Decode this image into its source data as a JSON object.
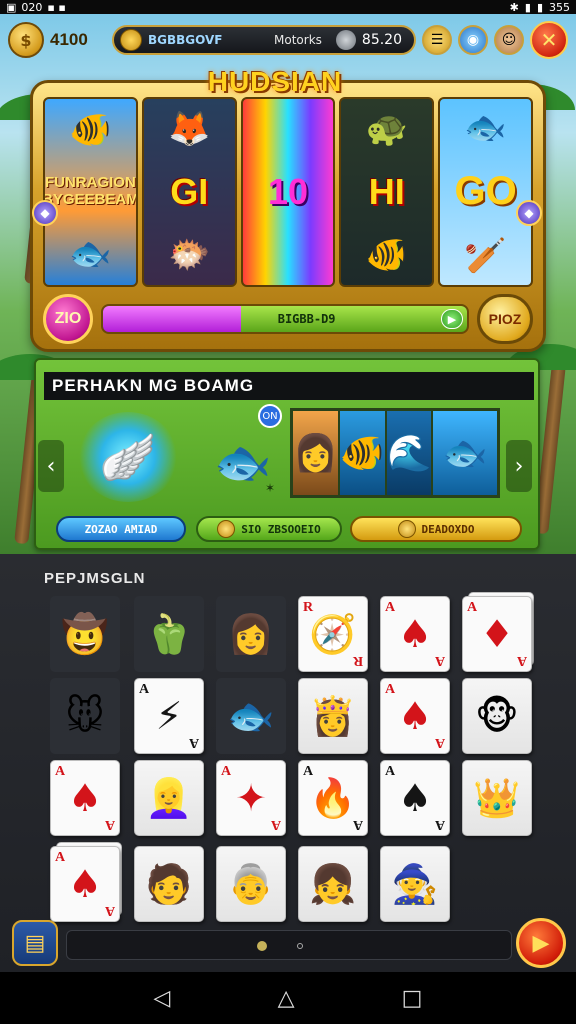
{
  "status_bar": {
    "left_text": "020",
    "right_text": "355"
  },
  "topbar": {
    "balance": "4100",
    "ticker_code": "BGBBGOVF",
    "ticker_label": "Motorks",
    "bet_value": "85.20",
    "icons": [
      "coin-icon",
      "menu-icon",
      "globe-icon",
      "avatar-icon",
      "close-icon"
    ]
  },
  "slot": {
    "title": "HUDSIAN",
    "reel_captions": [
      "FUNRAGION\nBYGEEBEAM",
      "GI",
      "10",
      "HI",
      "GO"
    ],
    "bet_bubble": "ZIO",
    "progress_text": "BIGBB-D9",
    "progress_fraction": 0.38,
    "play_bubble": "PIOZ"
  },
  "panel": {
    "header": "PERHAKN MG BOAMG",
    "badge": "ON",
    "buttons": [
      "ZOZAO AMIAD",
      "SIO ZBSOOEIO",
      "DEADOXDO"
    ]
  },
  "collection": {
    "title": "PEPJMSGLN",
    "tiles": [
      {
        "kind": "icon",
        "glyph": "🤠"
      },
      {
        "kind": "icon",
        "glyph": "🫑"
      },
      {
        "kind": "icon",
        "glyph": "👩"
      },
      {
        "kind": "card",
        "rank": "R",
        "glyph": "🧭",
        "color": "red"
      },
      {
        "kind": "card",
        "rank": "A",
        "glyph": "♠",
        "color": "red"
      },
      {
        "kind": "card",
        "rank": "A",
        "glyph": "♦",
        "color": "red",
        "stack": true
      },
      {
        "kind": "icon",
        "glyph": "🐭"
      },
      {
        "kind": "card",
        "rank": "A",
        "glyph": "⚡",
        "color": "blk"
      },
      {
        "kind": "icon",
        "glyph": "🐟"
      },
      {
        "kind": "portrait",
        "glyph": "👸"
      },
      {
        "kind": "card",
        "rank": "A",
        "glyph": "♠",
        "color": "red"
      },
      {
        "kind": "portrait",
        "glyph": "🐵"
      },
      {
        "kind": "card",
        "rank": "A",
        "glyph": "♠",
        "color": "red"
      },
      {
        "kind": "portrait",
        "glyph": "👱‍♀️"
      },
      {
        "kind": "card",
        "rank": "A",
        "glyph": "✦",
        "color": "red"
      },
      {
        "kind": "card",
        "rank": "A",
        "glyph": "🔥",
        "color": "blk"
      },
      {
        "kind": "card",
        "rank": "A",
        "glyph": "♠",
        "color": "blk"
      },
      {
        "kind": "portrait",
        "glyph": "👑"
      },
      {
        "kind": "card",
        "rank": "A",
        "glyph": "♠",
        "color": "red",
        "stack": true
      },
      {
        "kind": "portrait",
        "glyph": "🧑"
      },
      {
        "kind": "portrait",
        "glyph": "👵"
      },
      {
        "kind": "portrait",
        "glyph": "👧"
      },
      {
        "kind": "portrait",
        "glyph": "🧙"
      }
    ]
  },
  "navbar": {
    "back": "◁",
    "home": "△",
    "recent": "□"
  }
}
